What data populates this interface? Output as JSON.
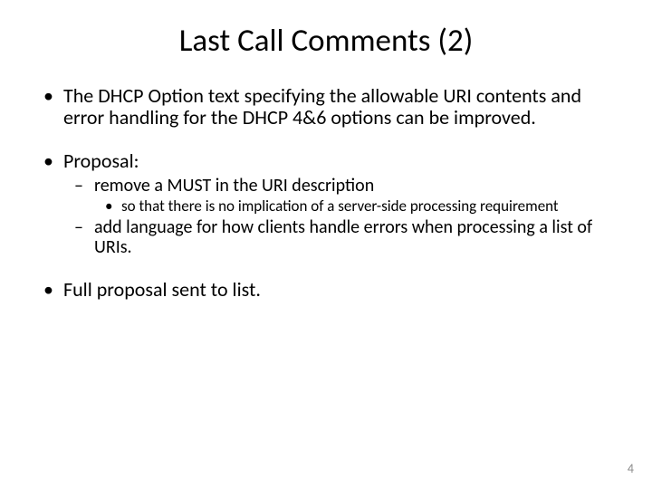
{
  "title": "Last Call Comments (2)",
  "bullets": {
    "item1": "The DHCP Option text specifying the allowable URI contents and error handling for the DHCP 4&6 options can be improved.",
    "item2": "Proposal:",
    "item2_sub1": "remove a MUST in the URI description",
    "item2_sub1_sub1": "so that there is no implication of a server-side processing requirement",
    "item2_sub2": "add language for how clients handle errors when processing a list of URIs.",
    "item3": "Full proposal sent to list."
  },
  "page_number": "4"
}
